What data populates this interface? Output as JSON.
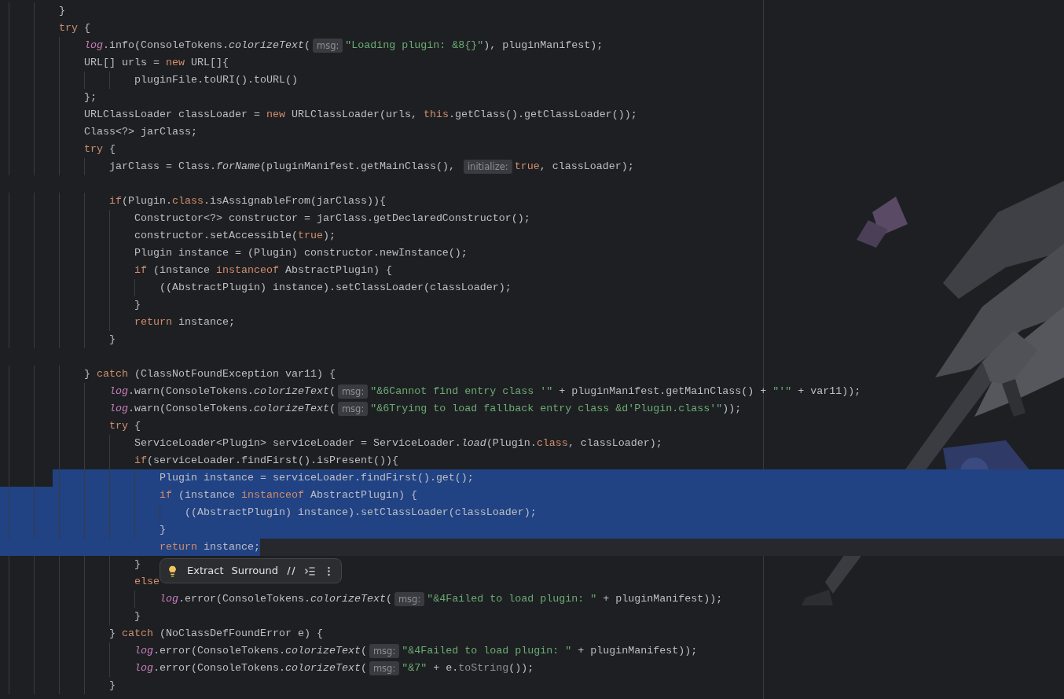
{
  "editor": {
    "lines": [
      {
        "selected": false,
        "tokens": [
          {
            "kind": "plain",
            "text": "        }"
          }
        ]
      },
      {
        "selected": false,
        "tokens": [
          {
            "kind": "keyword",
            "text": "        try"
          },
          {
            "kind": "plain",
            "text": " {"
          }
        ]
      },
      {
        "selected": false,
        "tokens": [
          {
            "kind": "field",
            "text": "            log"
          },
          {
            "kind": "plain",
            "text": ".info(ConsoleTokens."
          },
          {
            "kind": "static",
            "text": "colorizeText"
          },
          {
            "kind": "plain",
            "text": "("
          },
          {
            "kind": "hint",
            "text": "msg:"
          },
          {
            "kind": "string",
            "text": "\"Loading plugin: &8{}\""
          },
          {
            "kind": "plain",
            "text": "), pluginManifest);"
          }
        ]
      },
      {
        "selected": false,
        "tokens": [
          {
            "kind": "plain",
            "text": "            URL[] urls = "
          },
          {
            "kind": "keyword",
            "text": "new"
          },
          {
            "kind": "plain",
            "text": " URL[]{"
          }
        ]
      },
      {
        "selected": false,
        "tokens": [
          {
            "kind": "plain",
            "text": "                    pluginFile.toURI().toURL()"
          }
        ]
      },
      {
        "selected": false,
        "tokens": [
          {
            "kind": "plain",
            "text": "            };"
          }
        ]
      },
      {
        "selected": false,
        "tokens": [
          {
            "kind": "plain",
            "text": "            URLClassLoader classLoader = "
          },
          {
            "kind": "keyword",
            "text": "new"
          },
          {
            "kind": "plain",
            "text": " URLClassLoader(urls, "
          },
          {
            "kind": "keyword",
            "text": "this"
          },
          {
            "kind": "plain",
            "text": ".getClass().getClassLoader());"
          }
        ]
      },
      {
        "selected": false,
        "tokens": [
          {
            "kind": "plain",
            "text": "            Class<?> jarClass;"
          }
        ]
      },
      {
        "selected": false,
        "tokens": [
          {
            "kind": "keyword",
            "text": "            try"
          },
          {
            "kind": "plain",
            "text": " {"
          }
        ]
      },
      {
        "selected": false,
        "tokens": [
          {
            "kind": "plain",
            "text": "                jarClass = Class."
          },
          {
            "kind": "static",
            "text": "forName"
          },
          {
            "kind": "plain",
            "text": "(pluginManifest.getMainClass(), "
          },
          {
            "kind": "hint",
            "text": "initialize:"
          },
          {
            "kind": "keyword",
            "text": "true"
          },
          {
            "kind": "plain",
            "text": ", classLoader);"
          }
        ]
      },
      {
        "selected": false
      },
      {
        "selected": false,
        "tokens": [
          {
            "kind": "keyword",
            "text": "                if"
          },
          {
            "kind": "plain",
            "text": "(Plugin."
          },
          {
            "kind": "keyword",
            "text": "class"
          },
          {
            "kind": "plain",
            "text": ".isAssignableFrom(jarClass)){"
          }
        ]
      },
      {
        "selected": false,
        "tokens": [
          {
            "kind": "plain",
            "text": "                    Constructor<?> constructor = jarClass.getDeclaredConstructor();"
          }
        ]
      },
      {
        "selected": false,
        "tokens": [
          {
            "kind": "plain",
            "text": "                    constructor.setAccessible("
          },
          {
            "kind": "keyword",
            "text": "true"
          },
          {
            "kind": "plain",
            "text": ");"
          }
        ]
      },
      {
        "selected": false,
        "tokens": [
          {
            "kind": "plain",
            "text": "                    Plugin instance = (Plugin) constructor.newInstance();"
          }
        ]
      },
      {
        "selected": false,
        "tokens": [
          {
            "kind": "keyword",
            "text": "                    if"
          },
          {
            "kind": "plain",
            "text": " (instance "
          },
          {
            "kind": "keyword",
            "text": "instanceof"
          },
          {
            "kind": "plain",
            "text": " AbstractPlugin) {"
          }
        ]
      },
      {
        "selected": false,
        "tokens": [
          {
            "kind": "plain",
            "text": "                        ((AbstractPlugin) instance).setClassLoader(classLoader);"
          }
        ]
      },
      {
        "selected": false,
        "tokens": [
          {
            "kind": "plain",
            "text": "                    }"
          }
        ]
      },
      {
        "selected": false,
        "tokens": [
          {
            "kind": "keyword",
            "text": "                    return"
          },
          {
            "kind": "plain",
            "text": " instance;"
          }
        ]
      },
      {
        "selected": false,
        "tokens": [
          {
            "kind": "plain",
            "text": "                }"
          }
        ]
      },
      {
        "selected": false
      },
      {
        "selected": false,
        "tokens": [
          {
            "kind": "plain",
            "text": "            } "
          },
          {
            "kind": "keyword",
            "text": "catch"
          },
          {
            "kind": "plain",
            "text": " (ClassNotFoundException var11) {"
          }
        ]
      },
      {
        "selected": false,
        "tokens": [
          {
            "kind": "field",
            "text": "                log"
          },
          {
            "kind": "plain",
            "text": ".warn(ConsoleTokens."
          },
          {
            "kind": "static",
            "text": "colorizeText"
          },
          {
            "kind": "plain",
            "text": "("
          },
          {
            "kind": "hint",
            "text": "msg:"
          },
          {
            "kind": "string",
            "text": "\"&6Cannot find entry class '\""
          },
          {
            "kind": "plain",
            "text": " + pluginManifest.getMainClass() + "
          },
          {
            "kind": "string",
            "text": "\"'\""
          },
          {
            "kind": "plain",
            "text": " + var11));"
          }
        ]
      },
      {
        "selected": false,
        "tokens": [
          {
            "kind": "field",
            "text": "                log"
          },
          {
            "kind": "plain",
            "text": ".warn(ConsoleTokens."
          },
          {
            "kind": "static",
            "text": "colorizeText"
          },
          {
            "kind": "plain",
            "text": "("
          },
          {
            "kind": "hint",
            "text": "msg:"
          },
          {
            "kind": "string",
            "text": "\"&6Trying to load fallback entry class &d'Plugin.class'\""
          },
          {
            "kind": "plain",
            "text": "));"
          }
        ]
      },
      {
        "selected": false,
        "tokens": [
          {
            "kind": "keyword",
            "text": "                try"
          },
          {
            "kind": "plain",
            "text": " {"
          }
        ]
      },
      {
        "selected": false,
        "tokens": [
          {
            "kind": "plain",
            "text": "                    ServiceLoader<Plugin> serviceLoader = ServiceLoader."
          },
          {
            "kind": "static",
            "text": "load"
          },
          {
            "kind": "plain",
            "text": "(Plugin."
          },
          {
            "kind": "keyword",
            "text": "class"
          },
          {
            "kind": "plain",
            "text": ", classLoader);"
          }
        ]
      },
      {
        "selected": false,
        "tokens": [
          {
            "kind": "keyword",
            "text": "                    if"
          },
          {
            "kind": "plain",
            "text": "(serviceLoader.findFirst().isPresent()){"
          }
        ]
      },
      {
        "selected": true,
        "tokens": [
          {
            "kind": "plain",
            "text": "                        Plugin instance = serviceLoader.findFirst().get();"
          }
        ]
      },
      {
        "selected": true,
        "tokens": [
          {
            "kind": "keyword",
            "text": "                        if"
          },
          {
            "kind": "plain",
            "text": " (instance "
          },
          {
            "kind": "keyword",
            "text": "instanceof"
          },
          {
            "kind": "plain",
            "text": " AbstractPlugin) {"
          }
        ]
      },
      {
        "selected": true,
        "tokens": [
          {
            "kind": "plain",
            "text": "                            ((AbstractPlugin) instance).setClassLoader(classLoader);"
          }
        ]
      },
      {
        "selected": true,
        "tokens": [
          {
            "kind": "plain",
            "text": "                        }"
          }
        ]
      },
      {
        "selected": true,
        "current": true,
        "tokens": [
          {
            "kind": "keyword",
            "text": "                        return"
          },
          {
            "kind": "plain",
            "text": " instance;"
          }
        ]
      },
      {
        "selected": false,
        "tokens": [
          {
            "kind": "plain",
            "text": "                    }"
          }
        ]
      },
      {
        "selected": false,
        "tokens": [
          {
            "kind": "keyword",
            "text": "                    else"
          }
        ]
      },
      {
        "selected": false,
        "tokens": [
          {
            "kind": "field",
            "text": "                        log"
          },
          {
            "kind": "plain",
            "text": ".error(ConsoleTokens."
          },
          {
            "kind": "static",
            "text": "colorizeText"
          },
          {
            "kind": "plain",
            "text": "("
          },
          {
            "kind": "hint",
            "text": "msg:"
          },
          {
            "kind": "string",
            "text": "\"&4Failed to load plugin: \""
          },
          {
            "kind": "plain",
            "text": " + pluginManifest));"
          }
        ]
      },
      {
        "selected": false,
        "tokens": [
          {
            "kind": "plain",
            "text": "                    }"
          }
        ]
      },
      {
        "selected": false,
        "tokens": [
          {
            "kind": "plain",
            "text": "                } "
          },
          {
            "kind": "keyword",
            "text": "catch"
          },
          {
            "kind": "plain",
            "text": " (NoClassDefFoundError e) {"
          }
        ]
      },
      {
        "selected": false,
        "tokens": [
          {
            "kind": "field",
            "text": "                    log"
          },
          {
            "kind": "plain",
            "text": ".error(ConsoleTokens."
          },
          {
            "kind": "static",
            "text": "colorizeText"
          },
          {
            "kind": "plain",
            "text": "("
          },
          {
            "kind": "hint",
            "text": "msg:"
          },
          {
            "kind": "string",
            "text": "\"&4Failed to load plugin: \""
          },
          {
            "kind": "plain",
            "text": " + pluginManifest));"
          }
        ]
      },
      {
        "selected": false,
        "tokens": [
          {
            "kind": "field",
            "text": "                    log"
          },
          {
            "kind": "plain",
            "text": ".error(ConsoleTokens."
          },
          {
            "kind": "static",
            "text": "colorizeText"
          },
          {
            "kind": "plain",
            "text": "("
          },
          {
            "kind": "hint",
            "text": "msg:"
          },
          {
            "kind": "string",
            "text": "\"&7\""
          },
          {
            "kind": "plain",
            "text": " + e."
          },
          {
            "kind": "dim",
            "text": "toString"
          },
          {
            "kind": "plain",
            "text": "());"
          }
        ]
      },
      {
        "selected": false,
        "tokens": [
          {
            "kind": "plain",
            "text": "                }"
          }
        ]
      }
    ]
  },
  "floating_toolbar": {
    "actions": [
      {
        "label": "Extract"
      },
      {
        "label": "Surround"
      }
    ]
  }
}
